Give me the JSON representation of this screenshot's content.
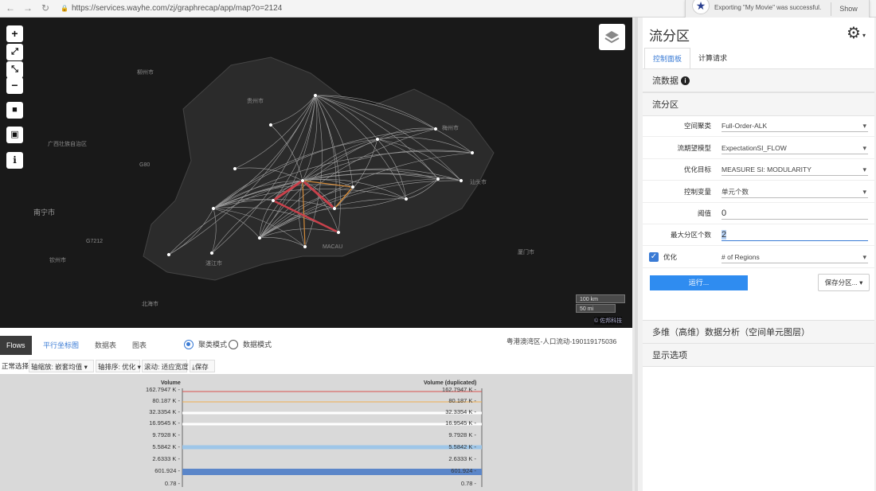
{
  "browser": {
    "url": "https://services.wayhe.com/zj/graphrecap/app/map?o=2124",
    "back_icon": "back-arrow-icon",
    "forward_icon": "forward-arrow-icon",
    "reload_icon": "reload-icon"
  },
  "notification": {
    "message": "Exporting \"My Movie\" was successful.",
    "action": "Show"
  },
  "map": {
    "tools": [
      "+",
      "⤢",
      "⤡",
      "−",
      "■",
      "💾",
      "i"
    ],
    "scale_km": "100 km",
    "scale_mi": "50 mi",
    "attribution": "© 佐邦科技",
    "places": [
      {
        "name": "南宁市",
        "big": true
      },
      {
        "name": "柳州市",
        "big": false
      },
      {
        "name": "广西壮族自治区",
        "big": false
      },
      {
        "name": "钦州市",
        "big": false
      },
      {
        "name": "北海市",
        "big": false
      },
      {
        "name": "湛江市",
        "big": false
      },
      {
        "name": "G7212",
        "big": false
      },
      {
        "name": "G80",
        "big": false
      },
      {
        "name": "贵州市",
        "big": false
      },
      {
        "name": "梅州市",
        "big": false
      },
      {
        "name": "汕头市",
        "big": false
      },
      {
        "name": "MACAU",
        "big": false
      },
      {
        "name": "厦门市",
        "big": false
      }
    ]
  },
  "bottom": {
    "tabs": [
      "Flows",
      "平行坐标图",
      "数据表",
      "图表"
    ],
    "active_tab": "平行坐标图",
    "modes": [
      "聚类模式",
      "数据模式"
    ],
    "dataset": "粤港澳湾区-人口流动-190119175036",
    "toolbar": [
      "正常选择",
      "轴缩放: 嵌套均值",
      "轴排序: 优化",
      "滚动: 适应宽度",
      "保存"
    ],
    "axes": [
      "Volume",
      "Volume (duplicated)"
    ],
    "ticks": [
      "162.7947 K",
      "80.187 K",
      "32.3354 K",
      "16.9545 K",
      "9.7928 K",
      "5.5842 K",
      "2.6333 K",
      "601.924",
      "0.78"
    ],
    "colors": {
      "red": "#d9534f",
      "orange": "#f0ad4e",
      "light_blue": "#9ec6e8",
      "blue": "#5b86c9"
    }
  },
  "panel": {
    "title": "流分区",
    "tabs": [
      "控制面板",
      "计算请求"
    ],
    "sections": [
      "流数据",
      "流分区"
    ],
    "fields": [
      {
        "label": "空间聚类",
        "value": "Full-Order-ALK",
        "type": "select"
      },
      {
        "label": "流期望模型",
        "value": "ExpectationSI_FLOW",
        "type": "select"
      },
      {
        "label": "优化目标",
        "value": "MEASURE SI: MODULARITY",
        "type": "select"
      },
      {
        "label": "控制变量",
        "value": "单元个数",
        "type": "select"
      },
      {
        "label": "阈值",
        "value": "0",
        "type": "input"
      },
      {
        "label": "最大分区个数",
        "value": "2",
        "type": "input-focus"
      }
    ],
    "optimize_label": "优化",
    "optimize_value": "# of Regions",
    "run_label": "运行...",
    "save_label": "保存分区... ▾",
    "bottom_sections": [
      "多维（高维）数据分析（空间单元图层）",
      "显示选项"
    ]
  }
}
